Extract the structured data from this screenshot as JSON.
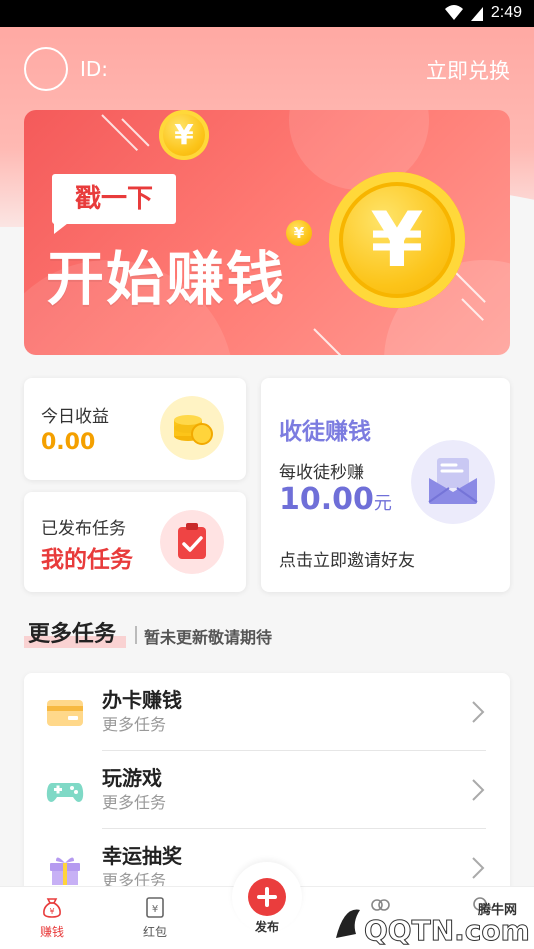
{
  "status_bar": {
    "time": "2:49"
  },
  "header": {
    "id_label": "ID:",
    "redeem_label": "立即兑换"
  },
  "banner": {
    "tag": "戳一下",
    "slogan": "开始赚钱",
    "coin_symbol": "¥"
  },
  "cards": {
    "income": {
      "label": "今日收益",
      "value": "0.00"
    },
    "tasks": {
      "label": "已发布任务",
      "value": "我的任务"
    },
    "invite": {
      "title": "收徒赚钱",
      "subtitle": "每收徒秒赚",
      "amount": "10.00",
      "unit": "元",
      "cta": "点击立即邀请好友"
    }
  },
  "more_tasks": {
    "title": "更多任务",
    "subtitle": "暂未更新敬请期待",
    "items": [
      {
        "title": "办卡赚钱",
        "subtitle": "更多任务",
        "icon": "card-icon"
      },
      {
        "title": "玩游戏",
        "subtitle": "更多任务",
        "icon": "gamepad-icon"
      },
      {
        "title": "幸运抽奖",
        "subtitle": "更多任务",
        "icon": "gift-icon"
      }
    ]
  },
  "tabbar": {
    "items": [
      {
        "label": "赚钱",
        "icon": "money-bag-icon",
        "active": true
      },
      {
        "label": "红包",
        "icon": "red-envelope-icon",
        "active": false
      },
      {
        "label": "发布",
        "icon": "plus-icon",
        "active": false
      },
      {
        "label": "",
        "icon": "message-icon",
        "active": false
      },
      {
        "label": "",
        "icon": "profile-icon",
        "active": false
      }
    ]
  },
  "watermark": {
    "text": "QQTN.com",
    "site": "腾牛网"
  },
  "colors": {
    "accent_red": "#e83b3b",
    "orange": "#f4a000",
    "purple": "#6f6fd8",
    "header_pink": "#ffa9a3"
  }
}
